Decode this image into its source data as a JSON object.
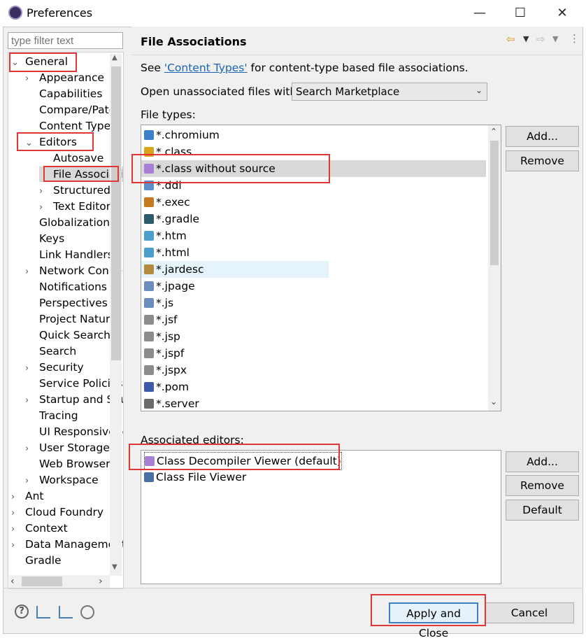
{
  "window": {
    "title": "Preferences",
    "minimize": "—",
    "maximize": "☐",
    "close": "✕"
  },
  "filter": {
    "placeholder": "type filter text"
  },
  "tree": {
    "items": [
      {
        "label": "General",
        "twisty": "⌄"
      },
      {
        "label": "Appearance",
        "twisty": "›"
      },
      {
        "label": "Capabilities",
        "twisty": ""
      },
      {
        "label": "Compare/Patch",
        "twisty": ""
      },
      {
        "label": "Content Types",
        "twisty": ""
      },
      {
        "label": "Editors",
        "twisty": "⌄"
      },
      {
        "label": "Autosave",
        "twisty": ""
      },
      {
        "label": "File Associations",
        "twisty": ""
      },
      {
        "label": "Structured",
        "twisty": "›"
      },
      {
        "label": "Text Editors",
        "twisty": "›"
      },
      {
        "label": "Globalization",
        "twisty": ""
      },
      {
        "label": "Keys",
        "twisty": ""
      },
      {
        "label": "Link Handlers",
        "twisty": ""
      },
      {
        "label": "Network Connections",
        "twisty": "›"
      },
      {
        "label": "Notifications",
        "twisty": ""
      },
      {
        "label": "Perspectives",
        "twisty": ""
      },
      {
        "label": "Project Natures",
        "twisty": ""
      },
      {
        "label": "Quick Search",
        "twisty": ""
      },
      {
        "label": "Search",
        "twisty": ""
      },
      {
        "label": "Security",
        "twisty": "›"
      },
      {
        "label": "Service Policies",
        "twisty": ""
      },
      {
        "label": "Startup and Shutdown",
        "twisty": "›"
      },
      {
        "label": "Tracing",
        "twisty": ""
      },
      {
        "label": "UI Responsiveness",
        "twisty": ""
      },
      {
        "label": "User Storage",
        "twisty": "›"
      },
      {
        "label": "Web Browser",
        "twisty": ""
      },
      {
        "label": "Workspace",
        "twisty": "›"
      },
      {
        "label": "Ant",
        "twisty": "›"
      },
      {
        "label": "Cloud Foundry",
        "twisty": "›"
      },
      {
        "label": "Context",
        "twisty": "›"
      },
      {
        "label": "Data Management",
        "twisty": "›"
      },
      {
        "label": "Gradle",
        "twisty": ""
      }
    ]
  },
  "panel": {
    "title": "File Associations",
    "see_prefix": "See ",
    "see_link": "'Content Types'",
    "see_suffix": " for content-type based file associations.",
    "open_label": "Open unassociated files with:",
    "open_value": "Search Marketplace",
    "file_types_label": "File types:",
    "file_types": [
      {
        "name": "*.chromium",
        "color": "#3d7fc9"
      },
      {
        "name": "*.class",
        "color": "#d9a520"
      },
      {
        "name": "*.class without source",
        "color": "#a97fd6"
      },
      {
        "name": "*.ddl",
        "color": "#5a8fc9"
      },
      {
        "name": "*.exec",
        "color": "#c77a20"
      },
      {
        "name": "*.gradle",
        "color": "#2d5d6b"
      },
      {
        "name": "*.htm",
        "color": "#4aa0c8"
      },
      {
        "name": "*.html",
        "color": "#4aa0c8"
      },
      {
        "name": "*.jardesc",
        "color": "#b38b3e"
      },
      {
        "name": "*.jpage",
        "color": "#6a8fbf"
      },
      {
        "name": "*.js",
        "color": "#6a8fbf"
      },
      {
        "name": "*.jsf",
        "color": "#8c8c8c"
      },
      {
        "name": "*.jsp",
        "color": "#8c8c8c"
      },
      {
        "name": "*.jspf",
        "color": "#8c8c8c"
      },
      {
        "name": "*.jspx",
        "color": "#8c8c8c"
      },
      {
        "name": "*.pom",
        "color": "#3c5aa8"
      },
      {
        "name": "*.server",
        "color": "#6a6a6a"
      }
    ],
    "add_label": "Add...",
    "remove_label": "Remove",
    "assoc_label": "Associated editors:",
    "editors": [
      {
        "name": "Class Decompiler Viewer (default)",
        "color": "#a97fd6"
      },
      {
        "name": "Class File Viewer",
        "color": "#4a6fa5"
      }
    ],
    "add2_label": "Add...",
    "remove2_label": "Remove",
    "default_label": "Default"
  },
  "footer": {
    "apply_close": "Apply and Close",
    "cancel": "Cancel",
    "help_glyph": "?"
  },
  "colors": {
    "highlight": "#e03636",
    "selection": "#d9d9d9",
    "hover": "#e5f3fb",
    "link": "#1a63b8"
  }
}
